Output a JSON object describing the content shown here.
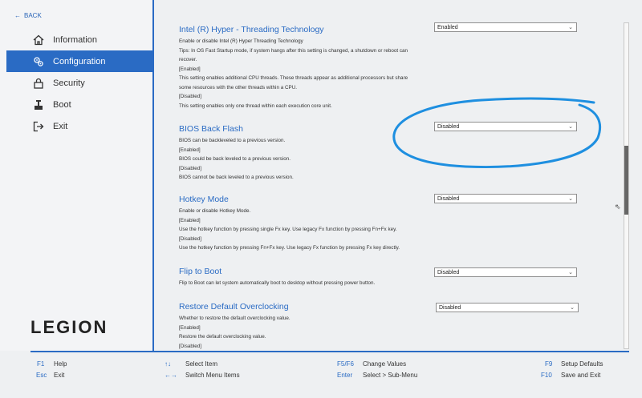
{
  "nav": {
    "back_label": "BACK",
    "items": [
      {
        "label": "Information",
        "icon": "house-icon"
      },
      {
        "label": "Configuration",
        "icon": "gears-icon"
      },
      {
        "label": "Security",
        "icon": "lock-icon"
      },
      {
        "label": "Boot",
        "icon": "boot-icon"
      },
      {
        "label": "Exit",
        "icon": "exit-icon"
      }
    ],
    "active": "Configuration",
    "logo": "LEGION"
  },
  "settings": [
    {
      "title": "Intel (R) Hyper - Threading Technology",
      "value": "Enabled",
      "desc": [
        "Enable or disable Intel (R) Hyper Threading Technology",
        "Tips: In OS Fast Startup mode, if system hangs after this setting is changed, a shutdown or reboot can recover.",
        "[Enabled]",
        "This setting enables additional CPU threads. These threads appear as additional processors but share some resources with the other threads within a CPU.",
        "[Disabled]",
        "This setting enables only one thread within each execution core unit."
      ]
    },
    {
      "title": "BIOS Back Flash",
      "value": "Disabled",
      "desc": [
        "BIOS can be backleveled to a previous version.",
        "[Enabled]",
        "BIOS could be back leveled to a previous version.",
        "[Disabled]",
        "BIOS cannot be back leveled to a previous version."
      ]
    },
    {
      "title": "Hotkey Mode",
      "value": "Disabled",
      "desc": [
        "Enable or disable Hotkey Mode.",
        "[Enabled]",
        "Use the hotkey function by pressing single Fx key. Use legacy Fx function by pressing Fn+Fx key.",
        "[Disabled]",
        "Use the hotkey function by pressing Fn+Fx key. Use legacy Fx function by pressing Fx key directly."
      ]
    },
    {
      "title": "Flip to Boot",
      "value": "Disabled",
      "desc": [
        "Flip to Boot can let system automatically boot to desktop without pressing power button."
      ]
    },
    {
      "title": "Restore Default Overclocking",
      "value": "Disabled",
      "desc": [
        "Whether to restore the default overclocking value.",
        "[Enabled]",
        "Restore the default overclocking value.",
        "[Disabled]"
      ]
    }
  ],
  "footer": [
    {
      "key": "F1",
      "text": "Help"
    },
    {
      "key": "Esc",
      "text": "Exit"
    },
    {
      "key": "↑↓",
      "text": "Select Item"
    },
    {
      "key": "←→",
      "text": "Switch Menu Items"
    },
    {
      "key": "F5/F6",
      "text": "Change Values"
    },
    {
      "key": "Enter",
      "text": "Select > Sub-Menu"
    },
    {
      "key": "F9",
      "text": "Setup Defaults"
    },
    {
      "key": "F10",
      "text": "Save and Exit"
    }
  ],
  "colors": {
    "accent": "#2a6bc4",
    "annotation": "#1e8fe0"
  }
}
